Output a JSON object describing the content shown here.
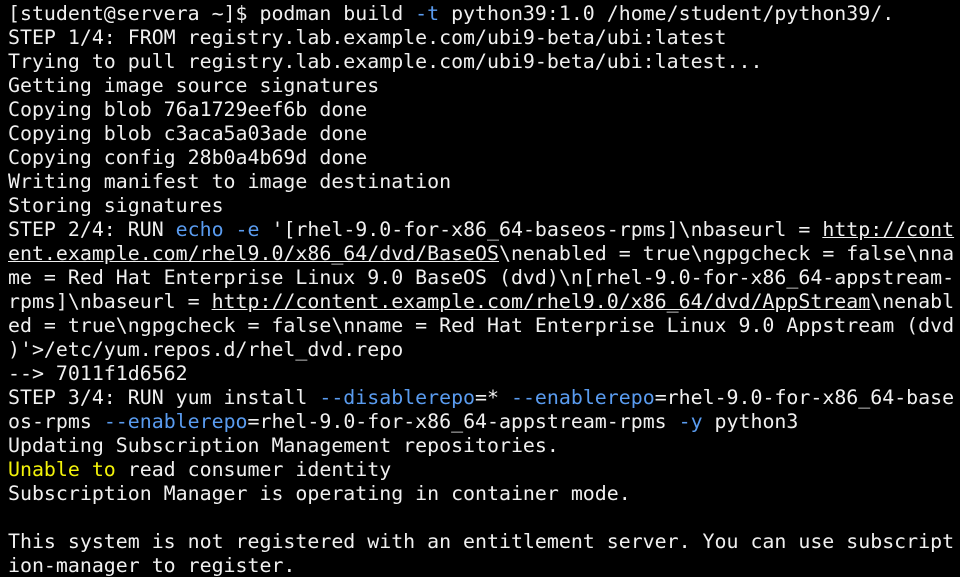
{
  "colors": {
    "background": "#000000",
    "text": "#f0f0f0",
    "option_blue": "#5a9cf0",
    "warning_yellow": "#f3f30a"
  },
  "terminal": {
    "lines": [
      [
        {
          "t": "[student@servera ~]$ podman build "
        },
        {
          "t": "-t",
          "c": "blue"
        },
        {
          "t": " python39:1.0 /home/student/python39/."
        }
      ],
      [
        {
          "t": "STEP 1/4: FROM registry.lab.example.com/ubi9-beta/ubi:latest"
        }
      ],
      [
        {
          "t": "Trying to pull registry.lab.example.com/ubi9-beta/ubi:latest..."
        }
      ],
      [
        {
          "t": "Getting image source signatures"
        }
      ],
      [
        {
          "t": "Copying blob 76a1729eef6b done"
        }
      ],
      [
        {
          "t": "Copying blob c3aca5a03ade done"
        }
      ],
      [
        {
          "t": "Copying config 28b0a4b69d done"
        }
      ],
      [
        {
          "t": "Writing manifest to image destination"
        }
      ],
      [
        {
          "t": "Storing signatures"
        }
      ],
      [
        {
          "t": "STEP 2/4: RUN "
        },
        {
          "t": "echo",
          "c": "blue"
        },
        {
          "t": " "
        },
        {
          "t": "-e",
          "c": "blue"
        },
        {
          "t": " '[rhel-9.0-for-x86_64-baseos-rpms]\\nbaseurl = "
        },
        {
          "t": "http://cont",
          "c": "link"
        }
      ],
      [
        {
          "t": "ent.example.com/rhel9.0/x86_64/dvd/BaseOS",
          "c": "link"
        },
        {
          "t": "\\nenabled = true\\ngpgcheck = false\\nna"
        }
      ],
      [
        {
          "t": "me = Red Hat Enterprise Linux 9.0 BaseOS (dvd)\\n[rhel-9.0-for-x86_64-appstream-"
        }
      ],
      [
        {
          "t": "rpms]\\nbaseurl = "
        },
        {
          "t": "http://content.example.com/rhel9.0/x86_64/dvd/AppStream",
          "c": "link"
        },
        {
          "t": "\\nenabl"
        }
      ],
      [
        {
          "t": "ed = true\\ngpgcheck = false\\nname = Red Hat Enterprise Linux 9.0 Appstream (dvd"
        }
      ],
      [
        {
          "t": ")'>/etc/yum.repos.d/rhel_dvd.repo"
        }
      ],
      [
        {
          "t": "--> 7011f1d6562"
        }
      ],
      [
        {
          "t": "STEP 3/4: RUN yum install "
        },
        {
          "t": "--disablerepo",
          "c": "blue"
        },
        {
          "t": "=* "
        },
        {
          "t": "--enablerepo",
          "c": "blue"
        },
        {
          "t": "=rhel-9.0-for-x86_64-base"
        }
      ],
      [
        {
          "t": "os-rpms "
        },
        {
          "t": "--enablerepo",
          "c": "blue"
        },
        {
          "t": "=rhel-9.0-for-x86_64-appstream-rpms "
        },
        {
          "t": "-y",
          "c": "blue"
        },
        {
          "t": " python3"
        }
      ],
      [
        {
          "t": "Updating Subscription Management repositories."
        }
      ],
      [
        {
          "t": "Unable to",
          "c": "yellow"
        },
        {
          "t": " read consumer identity"
        }
      ],
      [
        {
          "t": "Subscription Manager is operating in container mode."
        }
      ],
      [
        {
          "t": ""
        }
      ],
      [
        {
          "t": "This system is not registered with an entitlement server. You can use subscript"
        }
      ],
      [
        {
          "t": "ion-manager to register."
        }
      ]
    ]
  }
}
